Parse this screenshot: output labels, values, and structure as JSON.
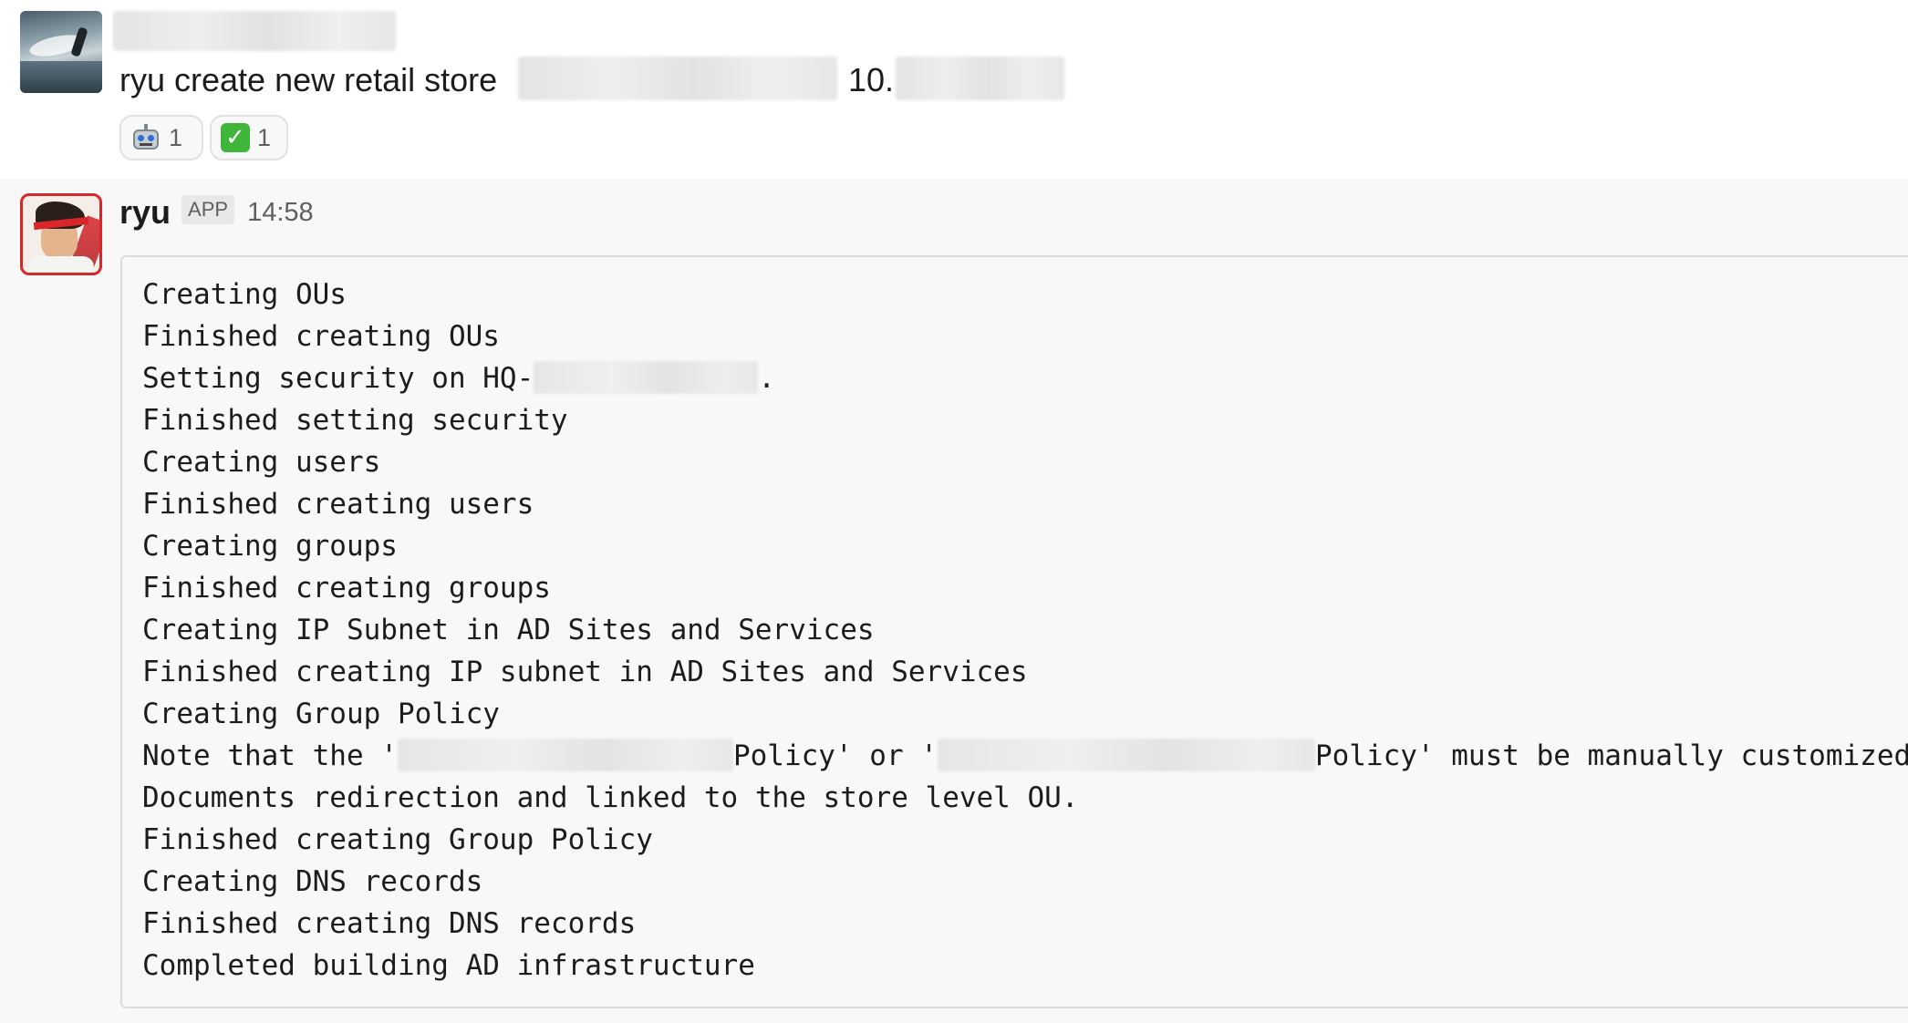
{
  "message1": {
    "text_before": "ryu create new retail store",
    "text_after": "10.",
    "reactions": [
      {
        "icon": "robot-face-icon",
        "count": "1"
      },
      {
        "icon": "white-check-mark-icon",
        "count": "1"
      }
    ]
  },
  "message2": {
    "sender": "ryu",
    "badge": "APP",
    "time": "14:58",
    "lines": [
      "Creating OUs",
      "Finished creating OUs",
      "Setting security on HQ-",
      ".",
      "Finished setting security",
      "Creating users",
      "Finished creating users",
      "Creating groups",
      "Finished creating groups",
      "Creating IP Subnet in AD Sites and Services",
      "Finished creating IP subnet in AD Sites and Services",
      "Creating Group Policy",
      "Note that the '",
      "Policy' or '",
      "Policy' must be manually customized w",
      "Documents redirection and linked to the store level OU.",
      "Finished creating Group Policy",
      "Creating DNS records",
      "Finished creating DNS records",
      "Completed building AD infrastructure"
    ]
  }
}
